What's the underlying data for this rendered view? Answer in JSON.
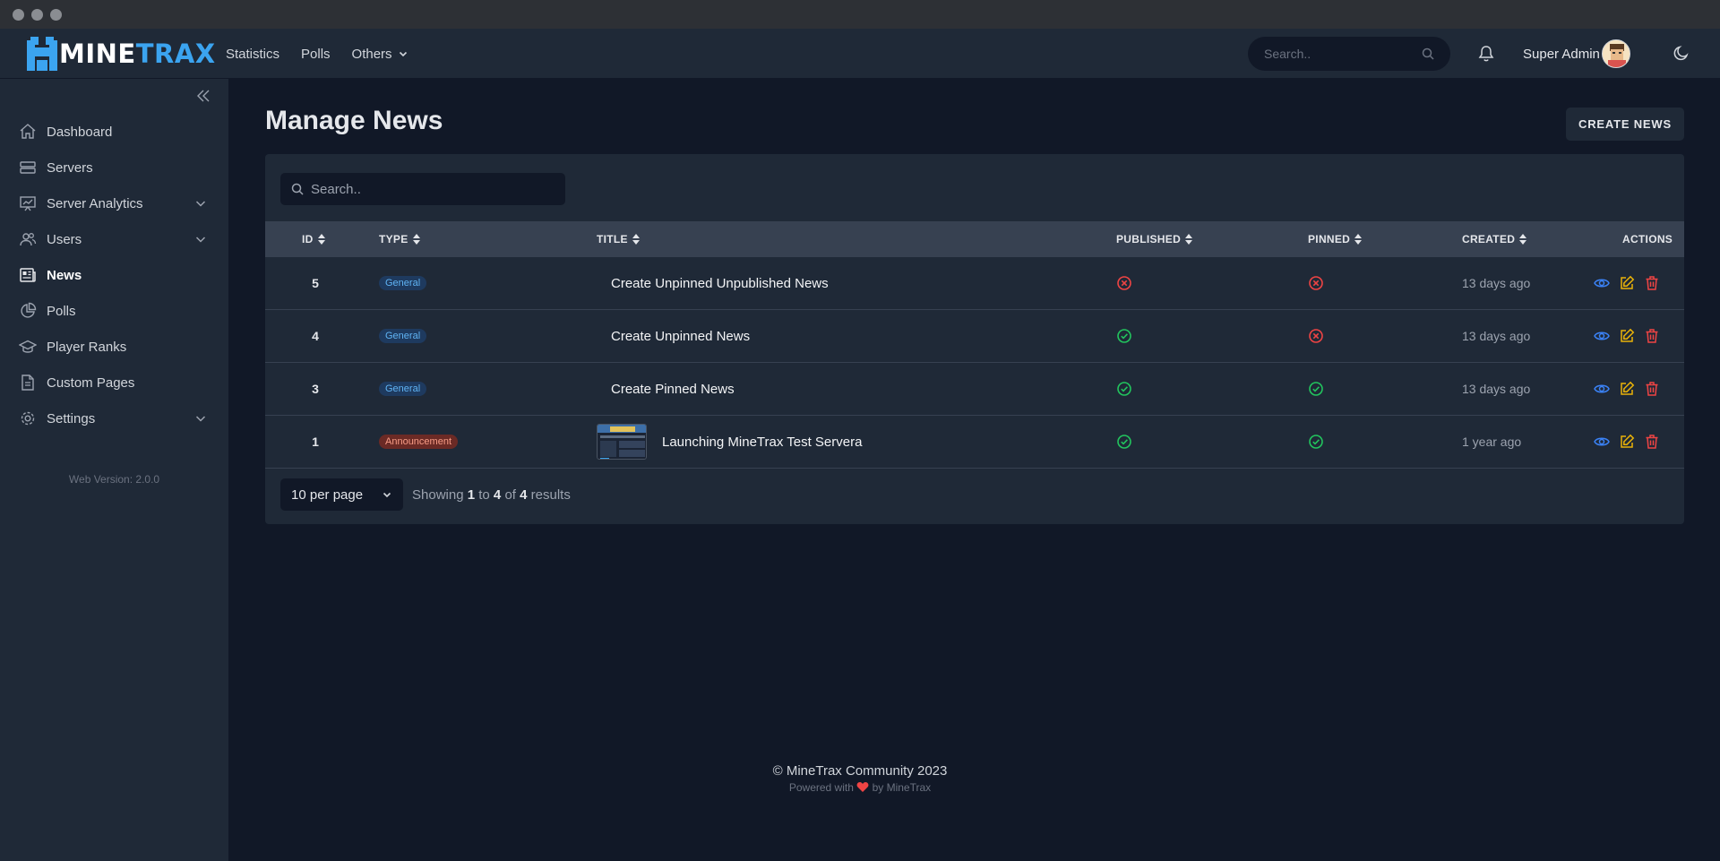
{
  "brand": {
    "part1": "MINE",
    "part2": "TRAX"
  },
  "topnav": {
    "links": [
      {
        "label": "Statistics"
      },
      {
        "label": "Polls"
      },
      {
        "label": "Others"
      }
    ],
    "search_placeholder": "Search..",
    "user_name": "Super Admin"
  },
  "sidebar": {
    "items": [
      {
        "label": "Dashboard",
        "icon": "home-icon"
      },
      {
        "label": "Servers",
        "icon": "server-icon"
      },
      {
        "label": "Server Analytics",
        "icon": "chart-icon"
      },
      {
        "label": "Users",
        "icon": "users-icon"
      },
      {
        "label": "News",
        "icon": "newspaper-icon"
      },
      {
        "label": "Polls",
        "icon": "pie-chart-icon"
      },
      {
        "label": "Player Ranks",
        "icon": "academic-cap-icon"
      },
      {
        "label": "Custom Pages",
        "icon": "document-icon"
      },
      {
        "label": "Settings",
        "icon": "gear-icon"
      }
    ],
    "active": "News",
    "web_version": "Web Version: 2.0.0"
  },
  "main": {
    "title": "Manage News",
    "create_button": "CREATE NEWS",
    "table_search_placeholder": "Search..",
    "columns": [
      "ID",
      "TYPE",
      "TITLE",
      "PUBLISHED",
      "PINNED",
      "CREATED",
      "ACTIONS"
    ],
    "rows": [
      {
        "id": "5",
        "type": "General",
        "title": "Create Unpinned Unpublished News",
        "published": false,
        "pinned": false,
        "created": "13 days ago",
        "has_image": false
      },
      {
        "id": "4",
        "type": "General",
        "title": "Create Unpinned News",
        "published": true,
        "pinned": false,
        "created": "13 days ago",
        "has_image": false
      },
      {
        "id": "3",
        "type": "General",
        "title": "Create Pinned News",
        "published": true,
        "pinned": true,
        "created": "13 days ago",
        "has_image": false
      },
      {
        "id": "1",
        "type": "Announcement",
        "title": "Launching MineTrax Test Servera",
        "published": true,
        "pinned": true,
        "created": "1 year ago",
        "has_image": true
      }
    ],
    "pagination": {
      "per_page_label": "10 per page",
      "showing_prefix": "Showing",
      "from": "1",
      "to_word": "to",
      "to": "4",
      "of_word": "of",
      "total": "4",
      "results_word": "results"
    }
  },
  "footer": {
    "copyright": "© MineTrax Community 2023",
    "powered_prefix": "Powered with",
    "powered_suffix": "by MineTrax"
  },
  "colors": {
    "accent_blue": "#3ba4f0",
    "success_green": "#22c55e",
    "danger_red": "#ef4444",
    "edit_yellow": "#eab308"
  }
}
